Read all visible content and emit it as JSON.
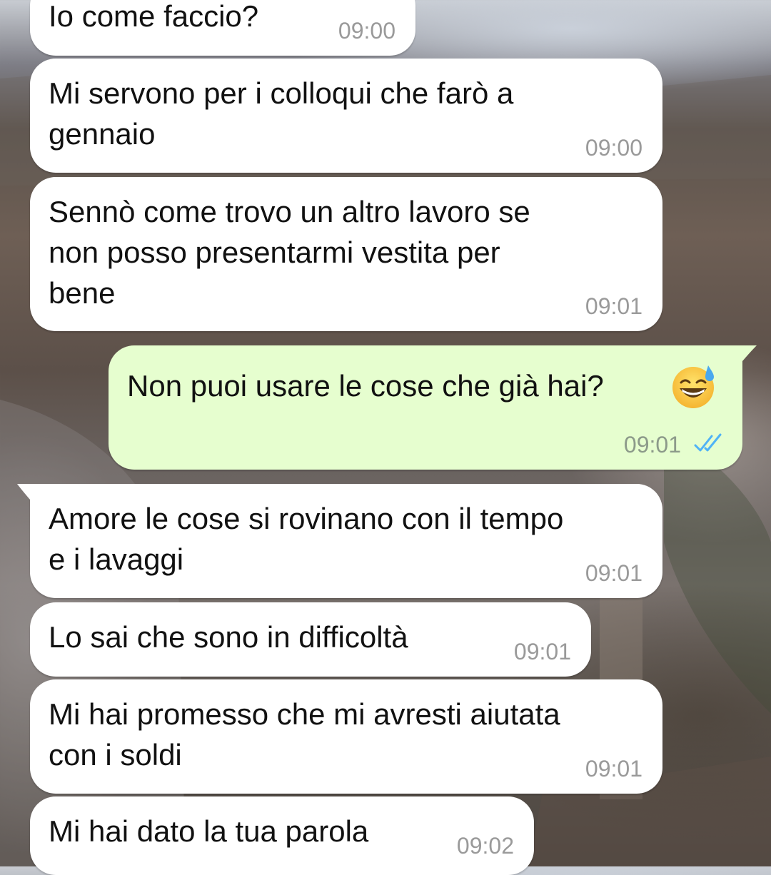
{
  "conversation": {
    "messages": [
      {
        "direction": "incoming",
        "text": "Io come faccio?",
        "time": "09:00"
      },
      {
        "direction": "incoming",
        "text": "Mi servono per i colloqui che farò a\ngennaio",
        "time": "09:00"
      },
      {
        "direction": "incoming",
        "text": "Sennò come trovo un altro lavoro se\nnon posso presentarmi vestita per\nbene",
        "time": "09:01"
      },
      {
        "direction": "outgoing",
        "text": "Non puoi usare le cose che già hai?",
        "time": "09:01",
        "emoji": "grinning-face-with-sweat",
        "status": "read-double-check-icon"
      },
      {
        "direction": "incoming",
        "text": "Amore le cose si rovinano con il tempo\ne i lavaggi",
        "time": "09:01"
      },
      {
        "direction": "incoming",
        "text": "Lo sai che sono in difficoltà",
        "time": "09:01"
      },
      {
        "direction": "incoming",
        "text": "Mi hai promesso che mi avresti aiutata\ncon i soldi",
        "time": "09:01"
      },
      {
        "direction": "incoming",
        "text": "Mi hai dato la tua parola",
        "time": "09:02"
      }
    ]
  },
  "colors": {
    "incoming_bubble": "#ffffff",
    "outgoing_bubble": "#e6fecf",
    "timestamp": "#9a9a9a",
    "read_ticks": "#4fb3f6",
    "text": "#111111"
  }
}
